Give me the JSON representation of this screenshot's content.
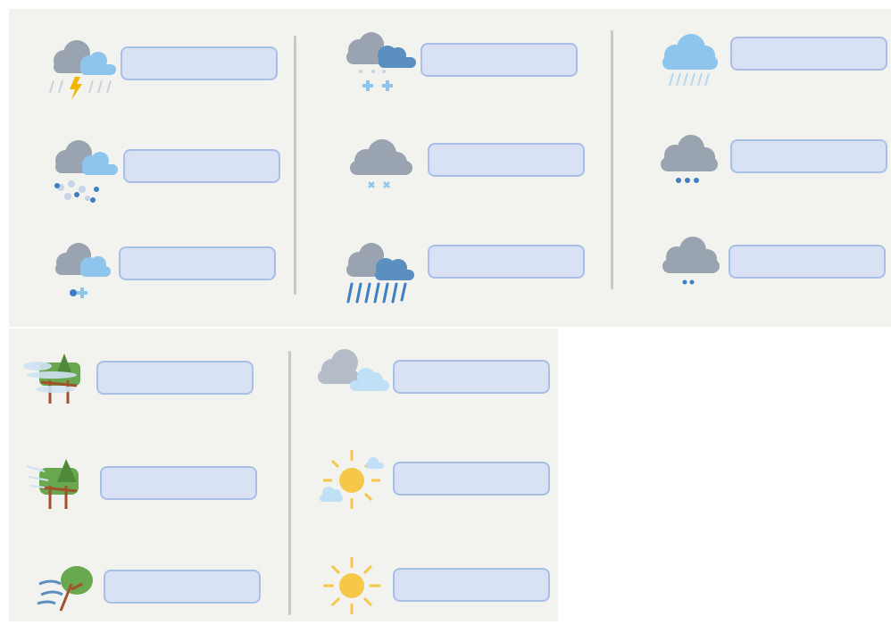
{
  "worksheet": {
    "weather_rows": [
      {
        "icon": "thunderstorm-icon",
        "answer": ""
      },
      {
        "icon": "sleet-icon",
        "answer": ""
      },
      {
        "icon": "drizzle-icon",
        "answer": ""
      },
      {
        "icon": "rain-and-snow-icon",
        "answer": ""
      },
      {
        "icon": "snow-icon",
        "answer": ""
      },
      {
        "icon": "showers-icon",
        "answer": ""
      },
      {
        "icon": "heavy-rain-icon",
        "answer": ""
      },
      {
        "icon": "light-rain-icon",
        "answer": ""
      },
      {
        "icon": "light-drizzle-icon",
        "answer": ""
      },
      {
        "icon": "fog-icon",
        "answer": ""
      },
      {
        "icon": "breeze-icon",
        "answer": ""
      },
      {
        "icon": "wind-icon",
        "answer": ""
      },
      {
        "icon": "cloudy-icon",
        "answer": ""
      },
      {
        "icon": "partly-sunny-icon",
        "answer": ""
      },
      {
        "icon": "sunny-icon",
        "answer": ""
      }
    ]
  },
  "colors": {
    "panel": "#f2f2ee",
    "answer_box_fill": "#d9e2f4",
    "answer_box_border": "#a9bfe6",
    "cloud_grey": "#9aa3b0",
    "cloud_light_blue": "#8ec5ec",
    "cloud_dark_blue": "#5b8fbf",
    "sun": "#f6c84a",
    "lightning": "#f4b400",
    "tree_green": "#6aa84f",
    "trunk": "#a0522d"
  }
}
